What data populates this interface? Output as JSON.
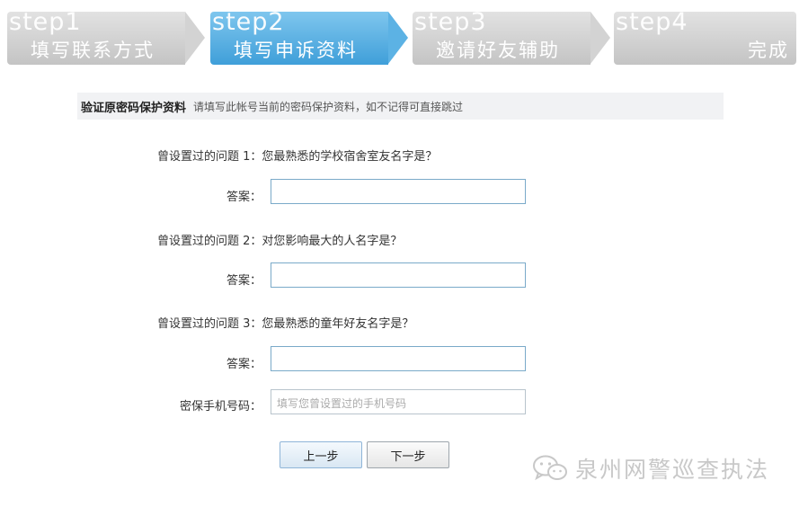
{
  "steps": [
    {
      "word": "step1",
      "title": "填写联系方式",
      "state": "inactive"
    },
    {
      "word": "step2",
      "title": "填写申诉资料",
      "state": "active"
    },
    {
      "word": "step3",
      "title": "邀请好友辅助",
      "state": "inactive"
    },
    {
      "word": "step4",
      "title": "完成",
      "state": "inactive"
    }
  ],
  "section": {
    "title": "验证原密码保护资料",
    "subtitle": "请填写此帐号当前的密码保护资料，如不记得可直接跳过"
  },
  "questions": [
    {
      "label": "曾设置过的问题 1：您最熟悉的学校宿舍室友名字是？",
      "answer_label": "答案：",
      "answer_value": ""
    },
    {
      "label": "曾设置过的问题 2：对您影响最大的人名字是？",
      "answer_label": "答案：",
      "answer_value": ""
    },
    {
      "label": "曾设置过的问题 3：您最熟悉的童年好友名字是？",
      "answer_label": "答案：",
      "answer_value": ""
    }
  ],
  "phone": {
    "label": "密保手机号码：",
    "placeholder": "填写您曾设置过的手机号码"
  },
  "buttons": {
    "prev": "上一步",
    "next": "下一步"
  },
  "watermark": {
    "text": "泉州网警巡查执法",
    "icon": "wechat-icon"
  },
  "colors": {
    "active_step": "#4aa8e0",
    "inactive_step": "#cccccc",
    "input_border": "#7aaac9"
  }
}
